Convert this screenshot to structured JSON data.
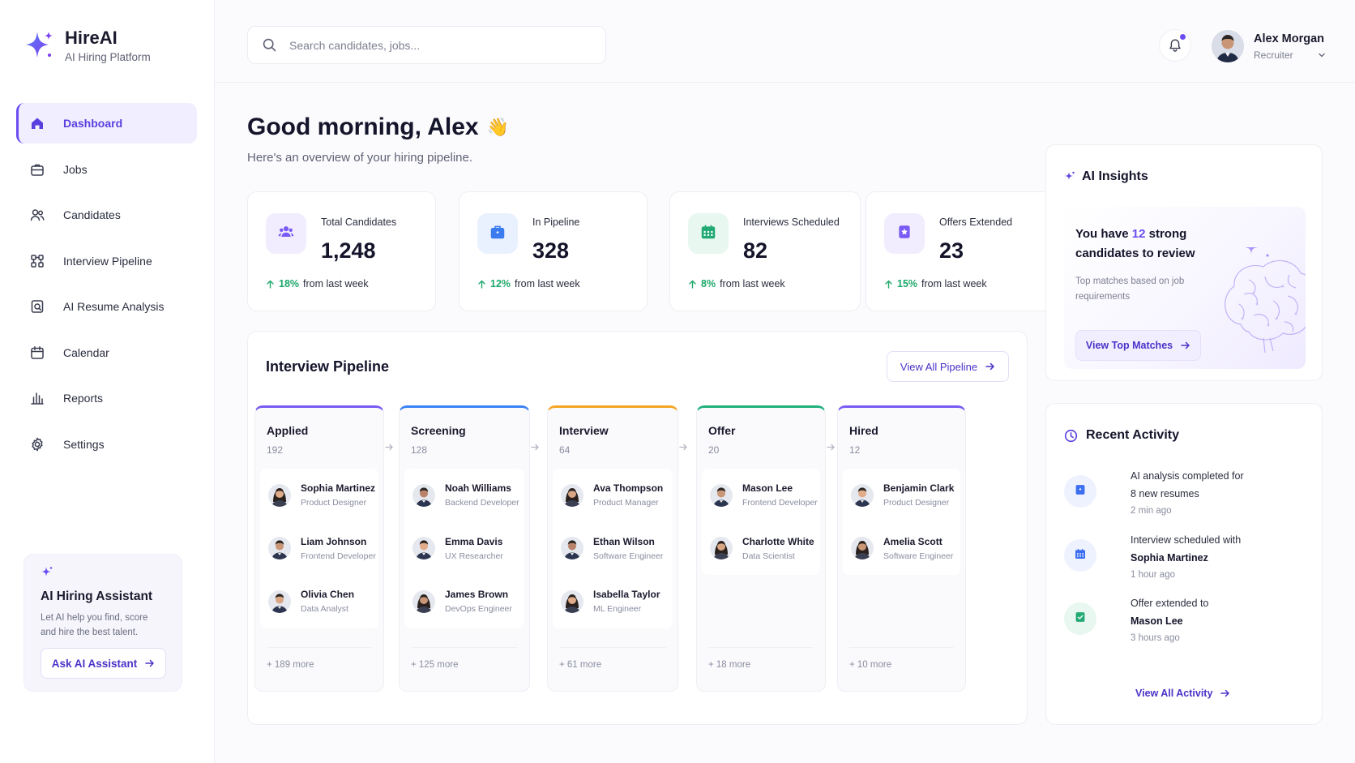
{
  "brand": {
    "name": "HireAI",
    "subtitle": "AI Hiring Platform"
  },
  "sidebar": {
    "items": [
      {
        "label": "Dashboard",
        "icon": "home-icon",
        "active": true
      },
      {
        "label": "Jobs",
        "icon": "briefcase-icon"
      },
      {
        "label": "Candidates",
        "icon": "users-icon"
      },
      {
        "label": "Interview Pipeline",
        "icon": "pipeline-icon"
      },
      {
        "label": "AI Resume Analysis",
        "icon": "resume-scan-icon"
      },
      {
        "label": "Calendar",
        "icon": "calendar-icon"
      },
      {
        "label": "Reports",
        "icon": "bar-chart-icon"
      },
      {
        "label": "Settings",
        "icon": "gear-icon"
      }
    ],
    "assistant": {
      "title": "AI Hiring Assistant",
      "text": "Let AI help you find, score and hire the best talent.",
      "button": "Ask AI Assistant"
    }
  },
  "header": {
    "search_placeholder": "Search candidates, jobs...",
    "user": {
      "name": "Alex Morgan",
      "role": "Recruiter"
    }
  },
  "greeting": {
    "title": "Good morning, Alex",
    "emoji": "👋",
    "subtitle": "Here's an overview of your hiring pipeline."
  },
  "stats": [
    {
      "label": "Total Candidates",
      "value": "1,248",
      "pct": "18%",
      "trend": "from last week",
      "icon": "users-icon",
      "color": "#7a5af5",
      "bg": "#f1edfe"
    },
    {
      "label": "In Pipeline",
      "value": "328",
      "pct": "12%",
      "trend": "from last week",
      "icon": "briefcase-icon",
      "color": "#3b7bf0",
      "bg": "#eaf1fe"
    },
    {
      "label": "Interviews Scheduled",
      "value": "82",
      "pct": "8%",
      "trend": "from last week",
      "icon": "calendar-icon",
      "color": "#22a974",
      "bg": "#e8f7f0"
    },
    {
      "label": "Offers Extended",
      "value": "23",
      "pct": "15%",
      "trend": "from last week",
      "icon": "badge-star-icon",
      "color": "#7a5af5",
      "bg": "#f1edfe"
    }
  ],
  "pipeline": {
    "title": "Interview Pipeline",
    "view_all": "View All Pipeline",
    "columns": [
      {
        "title": "Applied",
        "count": "192",
        "color": "#7a5af5",
        "more": "+ 189 more",
        "candidates": [
          {
            "name": "Sophia Martinez",
            "role": "Product Designer",
            "g": "f"
          },
          {
            "name": "Liam Johnson",
            "role": "Frontend Developer",
            "g": "m"
          },
          {
            "name": "Olivia Chen",
            "role": "Data Analyst",
            "g": "m"
          }
        ]
      },
      {
        "title": "Screening",
        "count": "128",
        "color": "#3b82f6",
        "more": "+ 125 more",
        "candidates": [
          {
            "name": "Noah Williams",
            "role": "Backend Developer",
            "g": "m"
          },
          {
            "name": "Emma Davis",
            "role": "UX Researcher",
            "g": "m"
          },
          {
            "name": "James Brown",
            "role": "DevOps Engineer",
            "g": "f"
          }
        ]
      },
      {
        "title": "Interview",
        "count": "64",
        "color": "#f5a524",
        "more": "+ 61 more",
        "candidates": [
          {
            "name": "Ava Thompson",
            "role": "Product Manager",
            "g": "f"
          },
          {
            "name": "Ethan Wilson",
            "role": "Software Engineer",
            "g": "m"
          },
          {
            "name": "Isabella Taylor",
            "role": "ML Engineer",
            "g": "f"
          }
        ]
      },
      {
        "title": "Offer",
        "count": "20",
        "color": "#22b07d",
        "more": "+ 18 more",
        "candidates": [
          {
            "name": "Mason Lee",
            "role": "Frontend Developer",
            "g": "m"
          },
          {
            "name": "Charlotte White",
            "role": "Data Scientist",
            "g": "f"
          }
        ]
      },
      {
        "title": "Hired",
        "count": "12",
        "color": "#7a5af5",
        "more": "+ 10 more",
        "candidates": [
          {
            "name": "Benjamin Clark",
            "role": "Product Designer",
            "g": "m"
          },
          {
            "name": "Amelia Scott",
            "role": "Software Engineer",
            "g": "f"
          }
        ]
      }
    ]
  },
  "insights": {
    "title": "AI Insights",
    "head_pre": "You have ",
    "head_num": "12",
    "head_post": " strong candidates to review",
    "text": "Top matches based on job requirements",
    "button": "View Top Matches"
  },
  "activity": {
    "title": "Recent Activity",
    "items": [
      {
        "line1": "AI analysis completed for",
        "line2": "8 new resumes",
        "time": "2 min ago",
        "icon": "ai-sparkle-icon",
        "color": "#3b6ff0",
        "bg": "#edf2fe"
      },
      {
        "line1": "Interview scheduled with",
        "line2": "Sophia Martinez",
        "time": "1 hour ago",
        "icon": "calendar-icon",
        "color": "#3b6ff0",
        "bg": "#edf2fe"
      },
      {
        "line1": "Offer extended to",
        "line2": "Mason Lee",
        "time": "3 hours ago",
        "icon": "offer-doc-icon",
        "color": "#22a974",
        "bg": "#e8f7f0"
      }
    ],
    "view_all": "View All Activity"
  },
  "colors": {
    "accent": "#6a4cf0",
    "positive": "#1ea86a"
  }
}
